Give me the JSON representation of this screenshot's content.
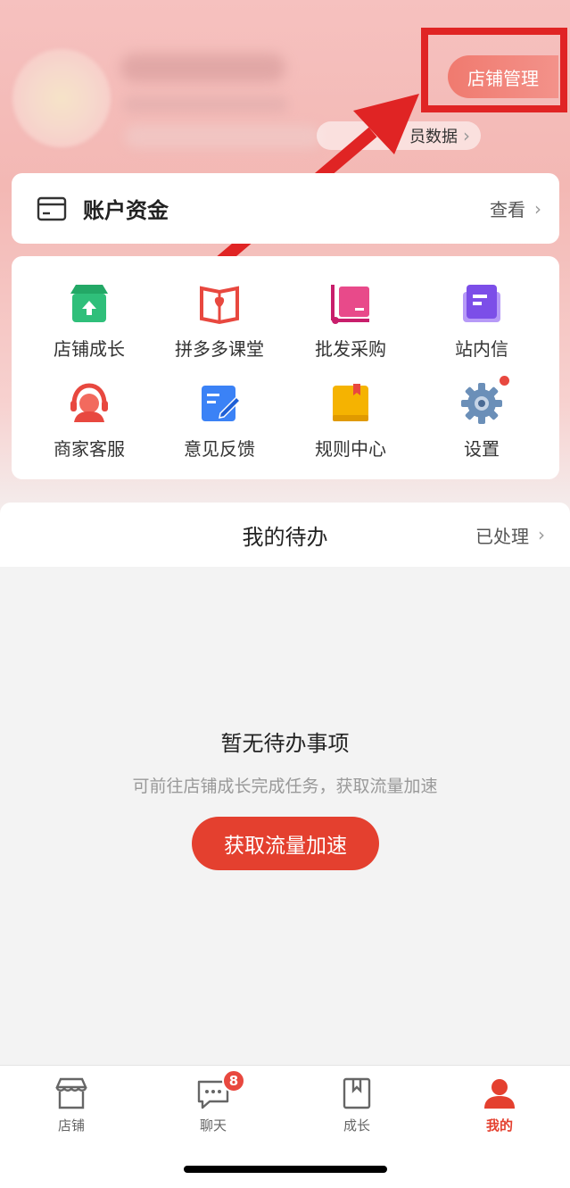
{
  "header": {
    "store_manage_label": "店铺管理",
    "data_link_label": "员数据"
  },
  "account": {
    "label": "账户资金",
    "view_label": "查看"
  },
  "grid": {
    "items": [
      {
        "label": "店铺成长",
        "icon": "store-growth-icon",
        "color": "#2fbf7a"
      },
      {
        "label": "拼多多课堂",
        "icon": "classroom-book-icon",
        "color": "#e8483f"
      },
      {
        "label": "批发采购",
        "icon": "wholesale-icon",
        "color": "#e84a8a"
      },
      {
        "label": "站内信",
        "icon": "message-icon",
        "color": "#8b5cf6"
      },
      {
        "label": "商家客服",
        "icon": "customer-service-icon",
        "color": "#e8483f"
      },
      {
        "label": "意见反馈",
        "icon": "feedback-edit-icon",
        "color": "#3b82f6"
      },
      {
        "label": "规则中心",
        "icon": "rules-book-icon",
        "color": "#f5b301"
      },
      {
        "label": "设置",
        "icon": "gear-icon",
        "color": "#6b8fb8"
      }
    ]
  },
  "todo": {
    "title": "我的待办",
    "done_label": "已处理",
    "empty_title": "暂无待办事项",
    "empty_sub": "可前往店铺成长完成任务，获取流量加速",
    "cta_label": "获取流量加速"
  },
  "tabs": [
    {
      "label": "店铺",
      "icon": "store-icon",
      "active": false
    },
    {
      "label": "聊天",
      "icon": "chat-icon",
      "active": false,
      "badge": "8"
    },
    {
      "label": "成长",
      "icon": "bookmark-icon",
      "active": false
    },
    {
      "label": "我的",
      "icon": "user-icon",
      "active": true
    }
  ],
  "colors": {
    "accent": "#e4402f",
    "annotation": "#e02424"
  }
}
